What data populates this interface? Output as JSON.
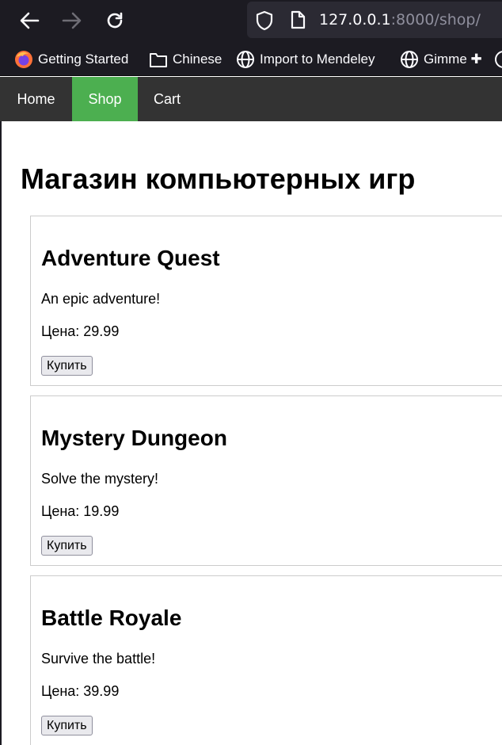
{
  "browser": {
    "url_host": "127.0.0.1",
    "url_rest": ":8000/shop/",
    "bookmarks": [
      {
        "label": "Getting Started",
        "icon": "firefox-icon"
      },
      {
        "label": "Chinese",
        "icon": "folder-icon"
      },
      {
        "label": "Import to Mendeley",
        "icon": "globe-icon"
      },
      {
        "label": "Gimme ✚",
        "icon": "globe-icon"
      }
    ]
  },
  "nav": {
    "items": [
      {
        "label": "Home"
      },
      {
        "label": "Shop"
      },
      {
        "label": "Cart"
      }
    ],
    "active": "Shop",
    "active_color": "#4caf50",
    "bar_color": "#333333"
  },
  "main": {
    "title": "Магазин компьютерных игр",
    "products": [
      {
        "name": "Adventure Quest",
        "description": "An epic adventure!",
        "price": "Цена: 29.99",
        "button": "Купить"
      },
      {
        "name": "Mystery Dungeon",
        "description": "Solve the mystery!",
        "price": "Цена: 19.99",
        "button": "Купить"
      },
      {
        "name": "Battle Royale",
        "description": "Survive the battle!",
        "price": "Цена: 39.99",
        "button": "Купить"
      }
    ]
  }
}
